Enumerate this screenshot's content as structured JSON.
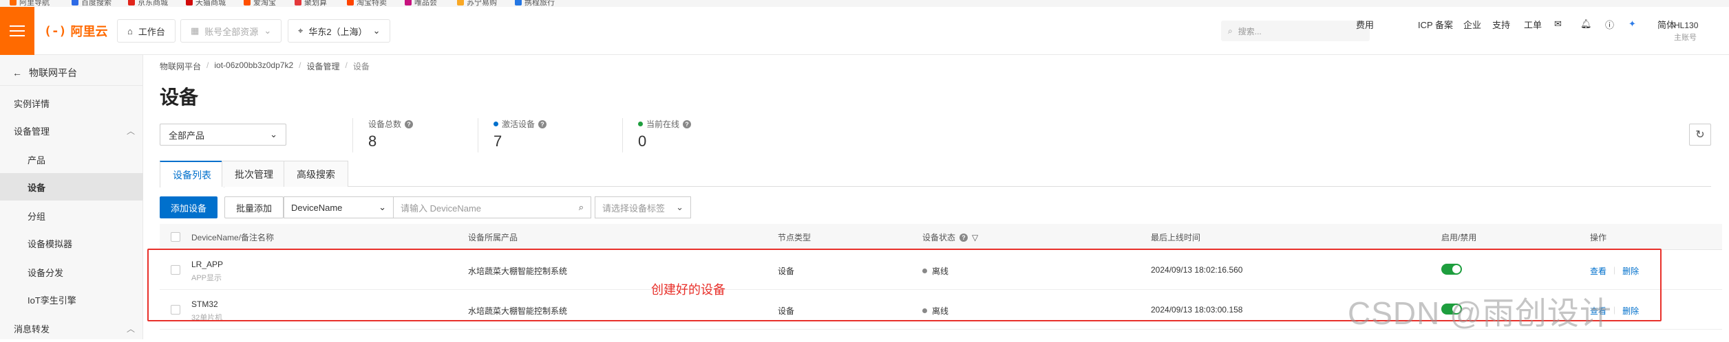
{
  "bookmarks": [
    "阿里导航",
    "百度搜索",
    "京东商城",
    "天猫商城",
    "爱淘宝",
    "聚划算",
    "淘宝特卖",
    "唯品会",
    "苏宁易购",
    "携程旅行"
  ],
  "topnav": {
    "logo_text": "阿里云",
    "workbench_label": "工作台",
    "account_label": "账号全部资源",
    "region_label": "华东2（上海）",
    "search_placeholder": "搜索...",
    "links": [
      "费用",
      "ICP 备案",
      "企业",
      "支持",
      "工单",
      "简体"
    ],
    "user_name": "HL130",
    "user_sub": "主账号"
  },
  "sidebar": {
    "back_label": "物联网平台",
    "items": [
      {
        "label": "实例详情"
      },
      {
        "label": "设备管理"
      },
      {
        "label": "产品"
      },
      {
        "label": "设备"
      },
      {
        "label": "分组"
      },
      {
        "label": "设备模拟器"
      },
      {
        "label": "设备分发"
      },
      {
        "label": "IoT孪生引擎"
      },
      {
        "label": "消息转发"
      }
    ]
  },
  "breadcrumb": [
    "物联网平台",
    "iot-06z00bb3z0dp7k2",
    "设备管理",
    "设备"
  ],
  "page_title": "设备",
  "product_select": "全部产品",
  "stats": [
    {
      "label": "设备总数",
      "value": "8"
    },
    {
      "label": "激活设备",
      "value": "7"
    },
    {
      "label": "当前在线",
      "value": "0"
    }
  ],
  "colors": {
    "activated_dot": "#0070cc",
    "online_dot": "#1e9e3e",
    "accent": "#0070cc",
    "brand": "#ff6a00",
    "annotation": "#e8302a"
  },
  "tabs": [
    "设备列表",
    "批次管理",
    "高级搜索"
  ],
  "toolbar": {
    "add_device": "添加设备",
    "batch_add": "批量添加",
    "search_field": "DeviceName",
    "search_placeholder": "请输入 DeviceName",
    "tag_placeholder": "请选择设备标签"
  },
  "table": {
    "headers": [
      "DeviceName/备注名称",
      "设备所属产品",
      "节点类型",
      "设备状态",
      "最后上线时间",
      "启用/禁用",
      "操作"
    ],
    "rows": [
      {
        "name": "LR_APP",
        "note": "APP显示",
        "product": "水培蔬菜大棚智能控制系统",
        "node_type": "设备",
        "status": "离线",
        "last_online": "2024/09/13 18:02:16.560",
        "enabled": true,
        "op_view": "查看",
        "op_delete": "删除"
      },
      {
        "name": "STM32",
        "note": "32单片机",
        "product": "水培蔬菜大棚智能控制系统",
        "node_type": "设备",
        "status": "离线",
        "last_online": "2024/09/13 18:03:00.158",
        "enabled": true,
        "op_view": "查看",
        "op_delete": "删除"
      }
    ]
  },
  "annotation": "创建好的设备",
  "watermark": "CSDN @雨创设计"
}
